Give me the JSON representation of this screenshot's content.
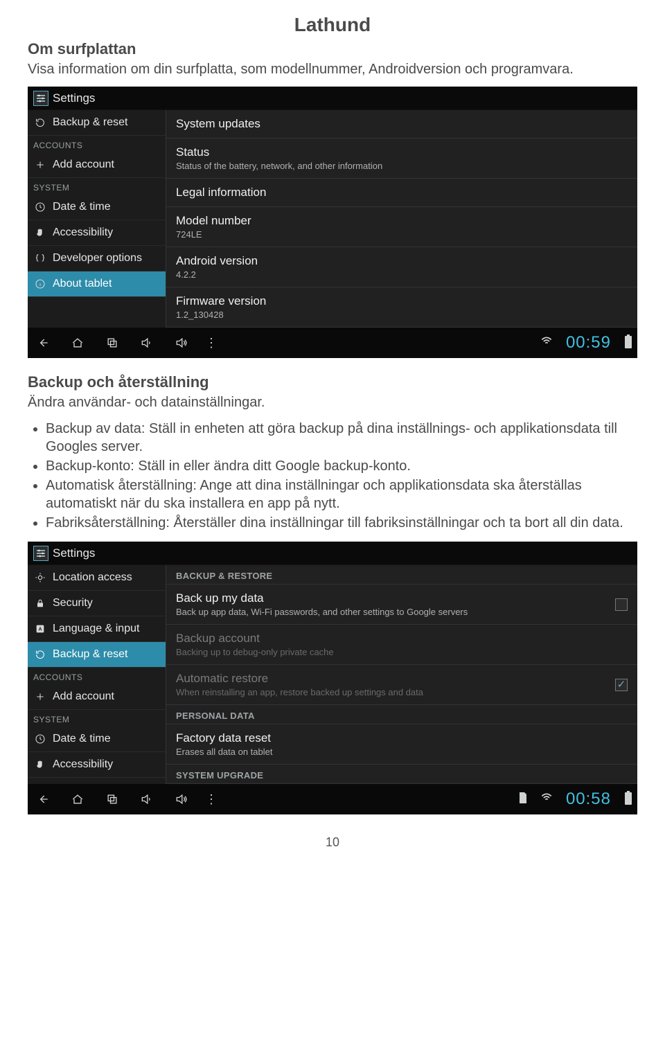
{
  "doc": {
    "title": "Lathund",
    "sec1_heading": "Om surfplattan",
    "sec1_body": "Visa information om din surfplatta, som modellnummer, Androidversion och programvara.",
    "sec2_heading": "Backup och återställning",
    "sec2_body": "Ändra användar- och datainställningar.",
    "bullets": [
      "Backup av data: Ställ in enheten att göra backup på dina inställnings- och applikationsdata till Googles server.",
      "Backup-konto: Ställ in eller ändra ditt Google backup-konto.",
      "Automatisk återställning: Ange att dina inställningar och applikationsdata ska återställas automatiskt när du ska installera en app på nytt.",
      "Fabriksåterställning: Återställer dina inställningar till fabriksinställningar och ta bort all din data."
    ],
    "pagenum": "10"
  },
  "shot1": {
    "topbar": "Settings",
    "side": {
      "items_top": [
        {
          "icon": "refresh",
          "label": "Backup & reset"
        }
      ],
      "hdr_accounts": "ACCOUNTS",
      "add_account": "Add account",
      "hdr_system": "SYSTEM",
      "items_sys": [
        {
          "icon": "clock",
          "label": "Date & time"
        },
        {
          "icon": "hand",
          "label": "Accessibility"
        },
        {
          "icon": "braces",
          "label": "Developer options"
        },
        {
          "icon": "info",
          "label": "About tablet",
          "active": true
        }
      ]
    },
    "main": [
      {
        "t1": "System updates"
      },
      {
        "t1": "Status",
        "t2": "Status of the battery, network, and other information"
      },
      {
        "t1": "Legal information"
      },
      {
        "t1": "Model number",
        "t2": "724LE"
      },
      {
        "t1": "Android version",
        "t2": "4.2.2"
      },
      {
        "t1": "Firmware version",
        "t2": "1.2_130428"
      }
    ],
    "clock": "00:59"
  },
  "shot2": {
    "topbar": "Settings",
    "side": {
      "items_top": [
        {
          "icon": "target",
          "label": "Location access"
        },
        {
          "icon": "lock",
          "label": "Security"
        },
        {
          "icon": "Abox",
          "label": "Language & input"
        },
        {
          "icon": "refresh",
          "label": "Backup & reset",
          "active": true
        }
      ],
      "hdr_accounts": "ACCOUNTS",
      "add_account": "Add account",
      "hdr_system": "SYSTEM",
      "items_sys": [
        {
          "icon": "clock",
          "label": "Date & time"
        },
        {
          "icon": "hand",
          "label": "Accessibility"
        }
      ]
    },
    "main_hdr1": "BACKUP & RESTORE",
    "main1": [
      {
        "t1": "Back up my data",
        "t2": "Back up app data, Wi-Fi passwords, and other settings to Google servers",
        "check": "empty"
      },
      {
        "t1": "Backup account",
        "t2": "Backing up to debug-only private cache",
        "disabled": true
      },
      {
        "t1": "Automatic restore",
        "t2": "When reinstalling an app, restore backed up settings and data",
        "disabled": true,
        "check": "checked"
      }
    ],
    "main_hdr2": "PERSONAL DATA",
    "main2": [
      {
        "t1": "Factory data reset",
        "t2": "Erases all data on tablet"
      }
    ],
    "main_hdr3": "SYSTEM UPGRADE",
    "clock": "00:58"
  }
}
